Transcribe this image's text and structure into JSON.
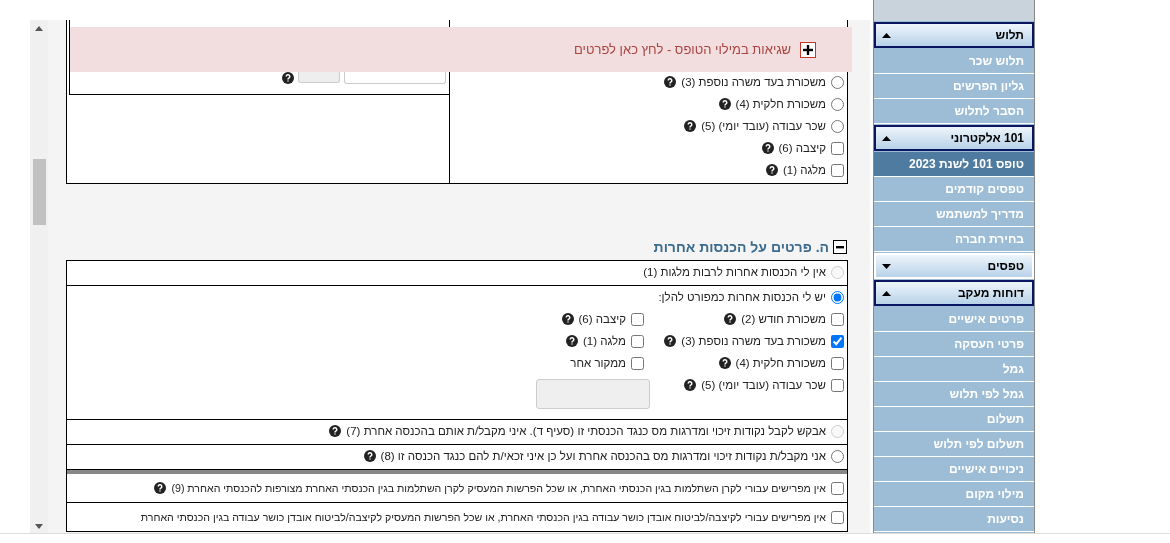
{
  "error_banner": {
    "text": "שגיאות במילוי הטופס  - לחץ כאן לפרטים"
  },
  "top_panel": {
    "options": [
      {
        "kind": "radio",
        "label": "משכורת בעד משרה נוספת (3)",
        "checked": false,
        "help": true
      },
      {
        "kind": "radio",
        "label": "משכורת חלקית (4)",
        "checked": false,
        "help": true
      },
      {
        "kind": "radio",
        "label": "שכר עבודה (עובד יומי) (5)",
        "checked": false,
        "help": true
      },
      {
        "kind": "checkbox",
        "label": "קיצבה (6)",
        "checked": false,
        "help": true
      },
      {
        "kind": "checkbox",
        "label": "מלגה (1)",
        "checked": false,
        "help": true
      }
    ]
  },
  "section": {
    "title": "ה. פרטים על הכנסות אחרות",
    "expanded": true,
    "rows": [
      {
        "kind": "radio",
        "label": "אין לי הכנסות אחרות לרבות מלגות (1)",
        "checked": false,
        "disabled": true,
        "help": false
      },
      {
        "kind": "radio",
        "label": "יש לי הכנסות אחרות כמפורט להלן:",
        "checked": true,
        "disabled": false,
        "help": false,
        "source_columns": [
          [
            {
              "label": "משכורת חודש (2)",
              "checked": false,
              "help": true
            },
            {
              "label": "משכורת בעד משרה נוספת (3)",
              "checked": true,
              "help": true
            },
            {
              "label": "משכורת חלקית (4)",
              "checked": false,
              "help": true
            },
            {
              "label": "שכר עבודה (עובד יומי) (5)",
              "checked": false,
              "help": true
            }
          ],
          [
            {
              "label": "קיצבה (6)",
              "checked": false,
              "help": true
            },
            {
              "label": "מלגה (1)",
              "checked": false,
              "help": true
            },
            {
              "label": "ממקור אחר",
              "checked": false,
              "help": false
            }
          ]
        ]
      },
      {
        "kind": "radio",
        "label": "אבקש לקבל נקודות זיכוי ומדרגות מס כנגד הכנסתי זו (סעיף ד). איני מקבל/ת אותם בהכנסה אחרת (7)",
        "checked": false,
        "disabled": true,
        "help": true
      },
      {
        "kind": "radio",
        "label": "אני מקבל/ת נקודות זיכוי ומדרגות מס בהכנסה אחרת ועל כן איני זכאי/ת להם כנגד הכנסה זו (8)",
        "checked": false,
        "disabled": false,
        "help": true
      }
    ],
    "declarations": [
      {
        "kind": "checkbox",
        "label": "אין מפרישים עבורי לקרן השתלמות בגין הכנסתי האחרת, או שכל הפרשות המעסיק לקרן השתלמות בגין הכנסתי האחרת מצורפות להכנסתי האחרת (9)",
        "checked": false,
        "help": true
      },
      {
        "kind": "checkbox",
        "label": "אין מפרישים עבורי לקיצבה/לביטוח אובדן כושר עבודה בגין הכנסתי האחרת, או שכל הפרשות המעסיק לקיצבה/לביטוח אובדן כושר עבודה בגין הכנסתי האחרת",
        "checked": false,
        "help": false
      }
    ]
  },
  "sidebar": {
    "groups": [
      {
        "title": "תלוש",
        "expanded": true,
        "items": [
          {
            "label": "תלוש שכר",
            "selected": false
          },
          {
            "label": "גליון הפרשים",
            "selected": false
          },
          {
            "label": "הסבר לתלוש",
            "selected": false
          }
        ]
      },
      {
        "title": "101 אלקטרוני",
        "expanded": true,
        "items": [
          {
            "label": "טופס 101 לשנת 2023",
            "selected": true
          },
          {
            "label": "טפסים קודמים",
            "selected": false
          },
          {
            "label": "מדריך למשתמש",
            "selected": false
          },
          {
            "label": "בחירת חברה",
            "selected": false
          }
        ]
      },
      {
        "title": "טפסים",
        "expanded": false
      },
      {
        "title": "דוחות מעקב",
        "expanded": true,
        "items": [
          {
            "label": "פרטים אישיים",
            "selected": false
          },
          {
            "label": "פרטי העסקה",
            "selected": false
          },
          {
            "label": "גמל",
            "selected": false
          },
          {
            "label": "גמל לפי תלוש",
            "selected": false
          },
          {
            "label": "תשלום",
            "selected": false
          },
          {
            "label": "תשלום לפי תלוש",
            "selected": false
          },
          {
            "label": "ניכויים אישיים",
            "selected": false
          },
          {
            "label": "מילוי מקום",
            "selected": false
          },
          {
            "label": "נסיעות",
            "selected": false
          }
        ]
      }
    ]
  }
}
